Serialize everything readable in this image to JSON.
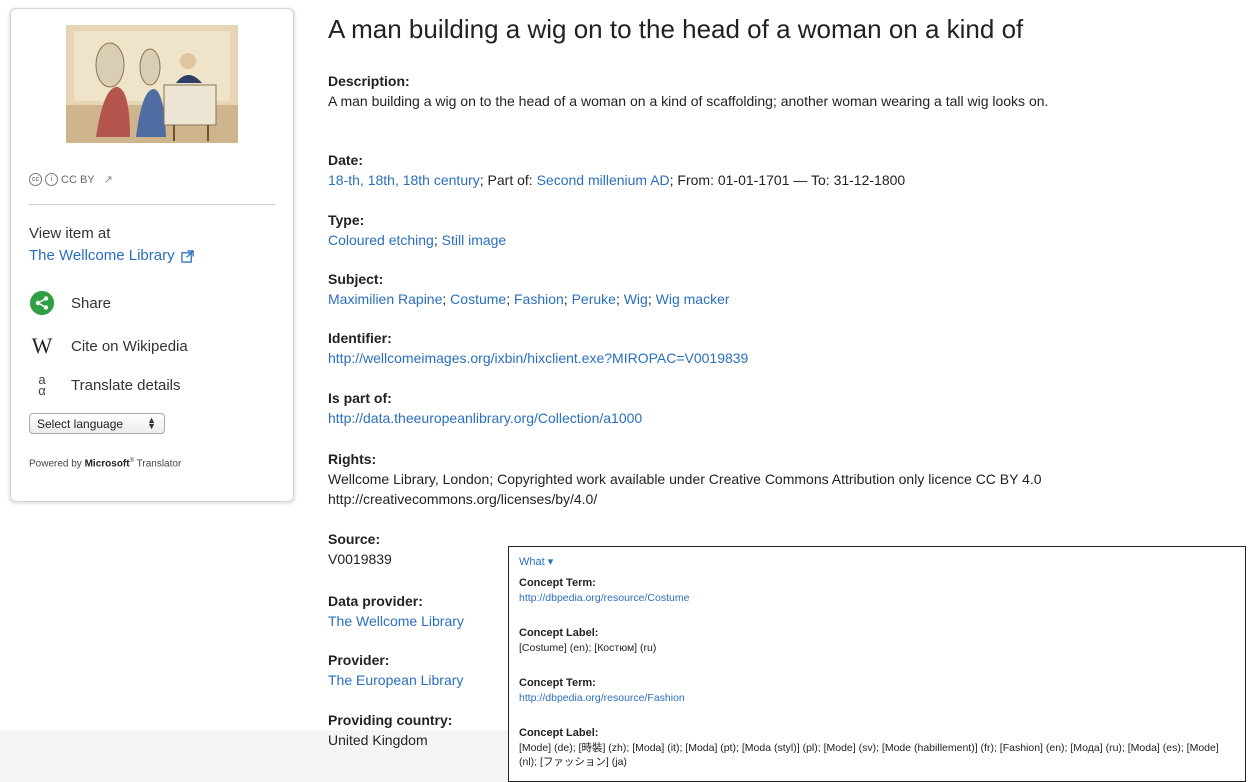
{
  "title": "A man building a wig on to the head of a woman on a kind of",
  "sidebar": {
    "license": "CC BY",
    "view_item_at": "View item at",
    "provider_link": "The Wellcome Library",
    "share": "Share",
    "cite": "Cite on Wikipedia",
    "translate": "Translate details",
    "select_language": "Select language",
    "powered_prefix": "Powered by",
    "powered_brand": "Microsoft",
    "powered_reg": "®",
    "powered_suffix": "Translator"
  },
  "fields": {
    "description": {
      "label": "Description:",
      "value": "A man building a wig on to the head of a woman on a kind of scaffolding; another woman wearing a tall wig looks on."
    },
    "date": {
      "label": "Date:",
      "link1": "18-th, 18th, 18th century",
      "sep1": "; Part of: ",
      "link2": "Second millenium AD",
      "rest": "; From: 01-01-1701 — To: 31-12-1800"
    },
    "type": {
      "label": "Type:",
      "items": [
        "Coloured etching",
        "Still image"
      ]
    },
    "subject": {
      "label": "Subject:",
      "items": [
        "Maximilien Rapine",
        "Costume",
        "Fashion",
        "Peruke",
        "Wig",
        "Wig macker"
      ]
    },
    "identifier": {
      "label": "Identifier:",
      "value": "http://wellcomeimages.org/ixbin/hixclient.exe?MIROPAC=V0019839"
    },
    "is_part_of": {
      "label": "Is part of:",
      "value": "http://data.theeuropeanlibrary.org/Collection/a1000"
    },
    "rights": {
      "label": "Rights:",
      "value": "Wellcome Library, London; Copyrighted work available under Creative Commons Attribution only licence CC BY 4.0 http://creativecommons.org/licenses/by/4.0/"
    },
    "source": {
      "label": "Source:",
      "value": "V0019839"
    },
    "data_provider": {
      "label": "Data provider:",
      "value": "The Wellcome Library"
    },
    "provider": {
      "label": "Provider:",
      "value": "The European Library"
    },
    "providing_country": {
      "label": "Providing country:",
      "value": "United Kingdom"
    }
  },
  "popup": {
    "what": "What ▾",
    "entries": [
      {
        "label": "Concept Term:",
        "value": "http://dbpedia.org/resource/Costume"
      },
      {
        "label": "Concept Label:",
        "value": "[Costume] (en); [Костюм] (ru)"
      },
      {
        "label": "Concept Term:",
        "value": "http://dbpedia.org/resource/Fashion"
      },
      {
        "label": "Concept Label:",
        "value": "[Mode] (de); [時裝] (zh); [Moda] (it); [Moda] (pt); [Moda (styl)] (pl); [Mode] (sv); [Mode (habillement)] (fr); [Fashion] (en); [Мода] (ru); [Moda] (es); [Mode] (nl); [ファッション] (ja)"
      }
    ]
  },
  "colors": {
    "link": "#2a6fbd",
    "share": "#2f9e44"
  }
}
